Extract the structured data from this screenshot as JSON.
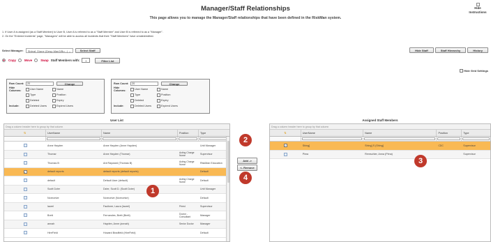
{
  "page": {
    "title": "Manager/Staff Relationships",
    "subtitle": "This page allows you to manage the Manager/Staff relationships that have been defined in the RiskMan system.",
    "hide_instructions": "Hide Instructions",
    "notes": [
      "1.  If User A is assigned (as a Staff Member) to User B, User A is referred to as a \"Staff Member\" and User B is referred to as a \"Manager\".",
      "2.  On the \"Entered Incidents\" page, \"Managers\" will be able to access all incidents that their \"Staff Members\" have created/edited."
    ]
  },
  "selector": {
    "label": "Select Manager:",
    "value": "Sbleaf, Diane (Desp.Man3/Bu...)",
    "button": "Select Staff"
  },
  "top_buttons": [
    "Hide Staff",
    "Staff Hierarchy",
    "History"
  ],
  "mode": {
    "options": [
      "Copy",
      "Move",
      "Swap"
    ],
    "selected": "Copy",
    "suffix": "Staff Members with:",
    "filter_button": "Filter List"
  },
  "hide_grid_settings": "Hide Grid Settings",
  "filter_boxes": [
    {
      "row_count_label": "Row Count:",
      "row_count": "20",
      "change": "Change",
      "hide_columns_label": "Hide Columns:",
      "cols": [
        "User Name",
        "Name",
        "Type",
        "Position",
        "Deleted",
        "Expiry"
      ],
      "include_label": "Include:",
      "include": [
        "Deleted Users",
        "Expired Users"
      ]
    },
    {
      "row_count_label": "Row Count:",
      "row_count": "20",
      "change": "Change",
      "hide_columns_label": "Hide Columns:",
      "cols": [
        "User Name",
        "Name",
        "Type",
        "Position",
        "Deleted",
        "Expiry"
      ],
      "include_label": "Include:",
      "include": [
        "Deleted Users",
        "Expired Users"
      ]
    }
  ],
  "user_list": {
    "title": "User List",
    "drag_hint": "Drag a column header here to group by that column",
    "columns": [
      "",
      "UserName",
      "Name",
      "Position",
      "Type"
    ],
    "rows": [
      {
        "user": "Anne Hayden",
        "name": "Anne Hayden (Anne Hayden)",
        "pos": "",
        "type": "Unit Manager"
      },
      {
        "user": "Thomar",
        "name": "Anne Hayden (Thomar)",
        "pos": "Acting Charge Nurse",
        "type": "Supervisor"
      },
      {
        "user": "Thomas B",
        "name": "Ant Rayward (Thomas B)",
        "pos": "Acting Charge Nurse",
        "type": "RiskMan Education"
      },
      {
        "user": "default reports",
        "name": "default reports (default reports)",
        "pos": "",
        "type": "Default"
      },
      {
        "user": "default",
        "name": "Default User (default)",
        "pos": "Acting Charge Nurse",
        "type": "Default"
      },
      {
        "user": "Scott Dzier",
        "name": "Dzier, Scott D. (Scott Dzier)",
        "pos": "",
        "type": "Unit Manager"
      },
      {
        "user": "Noreceive",
        "name": "Noreceive (Noreceive)",
        "pos": "",
        "type": "Default"
      },
      {
        "user": "laurel",
        "name": "Faulkner, Laura (laurel)",
        "pos": "Priest",
        "type": "Supervisor"
      },
      {
        "user": "Brett",
        "name": "Fernandes, Brett (Brett)",
        "pos": "Doctor - Consultant",
        "type": "Manager"
      },
      {
        "user": "annah",
        "name": "Hayden, Anne (annah)",
        "pos": "Senior Doctor",
        "type": "Manager"
      },
      {
        "user": "HireField",
        "name": "Howard Bradfield (HireField)",
        "pos": "",
        "type": "Default"
      }
    ]
  },
  "assigned": {
    "title": "Assigned Staff Members",
    "drag_hint": "Drag a column header here to group by that column",
    "columns": [
      "",
      "UserName",
      "Name",
      "Position",
      "Type"
    ],
    "rows": [
      {
        "user": "Shing]",
        "name": "Shing] S (Shing]",
        "pos": "CDC",
        "type": "Supervisor"
      },
      {
        "user": "Pima",
        "name": "Remschier, Anna (Pima)",
        "pos": "",
        "type": "Supervisor"
      }
    ]
  },
  "mid_buttons": {
    "add": "Add ->",
    "remove": "<- Remove"
  },
  "badges": [
    "1",
    "2",
    "3",
    "4"
  ],
  "colors": {
    "highlight": "#f9b954",
    "badge": "#c0392b",
    "accent": "#cc0033"
  }
}
